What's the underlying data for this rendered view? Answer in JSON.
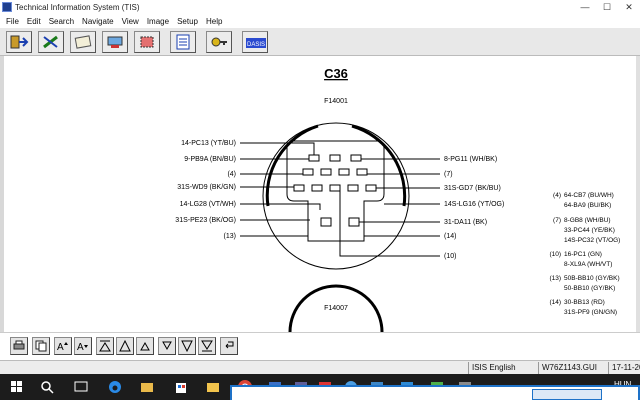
{
  "window": {
    "title": "Technical Information System (TIS)",
    "controls": {
      "minimize": "—",
      "maximize": "☐",
      "close": "✕"
    }
  },
  "menu": [
    "File",
    "Edit",
    "Search",
    "Navigate",
    "View",
    "Image",
    "Setup",
    "Help"
  ],
  "toolbar": {
    "buttons": [
      "exit-icon",
      "tools-icon",
      "document-icon",
      "vehicle-icon",
      "chip-icon",
      "checklist-icon",
      "key-icon",
      "dasis-icon"
    ],
    "dasis_label": "DASIS"
  },
  "diagram": {
    "connector_title": "C36",
    "top_connector_id": "F14001",
    "bottom_connector_id": "F14007",
    "left_labels": [
      "14-PC13 (YT/BU)",
      "9-PB9A (BN/BU)",
      "(4)",
      "31S-WD9 (BK/GN)",
      "14-LG28 (VT/WH)",
      "31S-PE23 (BK/OG)",
      "(13)"
    ],
    "right_labels": [
      "8-PG11 (WH/BK)",
      "(7)",
      "31S-GD7 (BK/BU)",
      "14S-LG16 (YT/OG)",
      "31-DA11 (BK)",
      "(14)",
      "(10)"
    ],
    "legend_groups": [
      {
        "pin": "(4)",
        "lines": [
          "64-CB7 (BU/WH)",
          "64-BA9 (BU/BK)"
        ]
      },
      {
        "pin": "(7)",
        "lines": [
          "8-GB8 (WH/BU)",
          "33-PC44 (YE/BK)",
          "14S-PC32 (VT/OG)"
        ]
      },
      {
        "pin": "(10)",
        "lines": [
          "16-PC1 (GN)",
          "8-XL9A (WH/VT)"
        ]
      },
      {
        "pin": "(13)",
        "lines": [
          "50B-BB10 (GY/BK)",
          "50-BB10 (GY/BK)"
        ]
      },
      {
        "pin": "(14)",
        "lines": [
          "30-BB13 (RD)",
          "31S-PF9 (GN/GN)"
        ]
      }
    ]
  },
  "navigation": {
    "buttons": [
      "print-icon",
      "copy-icon",
      "zoom-in-icon",
      "zoom-out-icon",
      "first-page-icon",
      "page-up-icon",
      "previous-icon",
      "next-icon",
      "page-down-icon",
      "last-page-icon",
      "back-icon"
    ]
  },
  "status": {
    "language": "ISIS English",
    "file": "W76Z1143.GUI",
    "date": "17-11-20"
  },
  "taskbar": {
    "icons": [
      "windows-start-icon",
      "search-icon",
      "task-view-icon",
      "edge-icon",
      "file-explorer-icon",
      "store-icon",
      "folder-icon",
      "chrome-icon",
      "app-icon-1",
      "app-icon-2",
      "app-icon-3",
      "app-icon-4",
      "app-icon-5",
      "app-icon-6",
      "app-icon-7",
      "app-icon-8"
    ],
    "tray_text": "HUN"
  }
}
